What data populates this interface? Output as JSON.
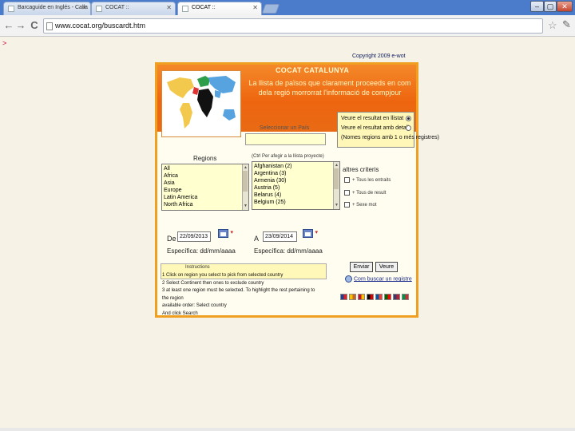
{
  "browser": {
    "tabs": [
      {
        "label": "Barcaguide en Inglés - Calla",
        "active": false
      },
      {
        "label": "COCAT ::",
        "active": false
      },
      {
        "label": "COCAT ::",
        "active": true
      }
    ],
    "url": "www.cocat.org/buscardt.htm",
    "window_controls": {
      "minimize": "–",
      "maximize": "▢",
      "close": "✕"
    },
    "nav": {
      "back": "←",
      "forward": "→",
      "reload": "C"
    }
  },
  "prompt_mark": ">",
  "copyright": "Copyright 2009 e-wot",
  "panel": {
    "title": "COCAT CATALUNYA",
    "subtitle": "La llista de països que clarament proceeds en com dela regió morrorrat l'informació de compjour",
    "select_country_label": "Seleccionar un País",
    "radio_options": [
      {
        "label": "Veure el resultat en llistat",
        "checked": true
      },
      {
        "label": "Veure el resultat amb detall",
        "checked": false
      },
      {
        "label": "(Nomes regions amb 1 o més registres)",
        "checked": false
      }
    ],
    "regions_label": "Regions",
    "regions": [
      "All",
      "Africa",
      "Asia",
      "Europe",
      "Latin America",
      "North Africa"
    ],
    "countries_note": "(Ctrl Per afegir a la llista proyecte)",
    "countries": [
      "Afghanistan (2)",
      "Argentina (3)",
      "Armenia (30)",
      "Austria (5)",
      "Belarus (4)",
      "Belgium (25)"
    ],
    "other_criteria_label": "altres criteris",
    "checkboxes": [
      "+ Tous les entraits",
      "+ Tous de result",
      "+ Sexe mot"
    ],
    "from_label": "De",
    "from_value": "22/09/2013",
    "to_label": "A",
    "to_value": "23/09/2014",
    "from_format": "Específica: dd/mm/aaaa",
    "to_format": "Específica: dd/mm/aaaa",
    "search_button": "Enviar",
    "clear_button": "Veure",
    "help_title": "Instructions",
    "help_lines": [
      "1 Click on region you select to pick from selected country",
      "2 Select Continent then ones to exclude country",
      "3 at least one region must be selected. To highlight the rest pertaining to the region",
      "   available order: Select country",
      "And click Search"
    ],
    "link_text": "Com buscar un registre",
    "flags": [
      {
        "name": "uk",
        "color": "#1c3f94",
        "accent": "#d22"
      },
      {
        "name": "catalonia",
        "color": "#f5c400",
        "accent": "#c62"
      },
      {
        "name": "spain",
        "color": "#c8102e",
        "accent": "#f5c400"
      },
      {
        "name": "germany",
        "color": "#000000",
        "accent": "#dd0000"
      },
      {
        "name": "france",
        "color": "#0055a4",
        "accent": "#ef4135"
      },
      {
        "name": "portugal",
        "color": "#006600",
        "accent": "#ff0000"
      },
      {
        "name": "usa",
        "color": "#3c3b6e",
        "accent": "#b22234"
      },
      {
        "name": "italy",
        "color": "#009246",
        "accent": "#ce2b37"
      }
    ]
  },
  "colors": {
    "header_orange": "#ee6510",
    "panel_border": "#f0a020",
    "input_yellow": "#ffffd0"
  }
}
